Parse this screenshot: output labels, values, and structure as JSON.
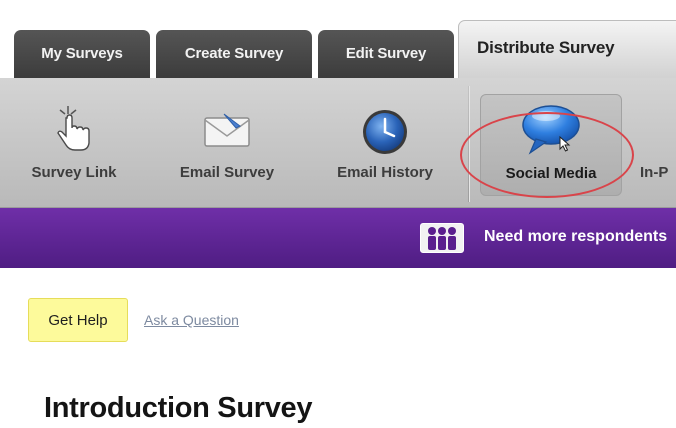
{
  "tabs": [
    {
      "label": "My Surveys"
    },
    {
      "label": "Create Survey"
    },
    {
      "label": "Edit Survey"
    },
    {
      "label": "Distribute Survey",
      "active": true
    }
  ],
  "toolbar": {
    "items": [
      {
        "label": "Survey Link",
        "icon": "hand-pointer-icon"
      },
      {
        "label": "Email Survey",
        "icon": "envelope-icon"
      },
      {
        "label": "Email History",
        "icon": "clock-icon"
      },
      {
        "label": "Social Media",
        "icon": "speech-bubble-icon",
        "selected": true
      },
      {
        "label": "In-P",
        "icon": ""
      }
    ]
  },
  "banner": {
    "text": "Need more respondents",
    "icon": "people-icon"
  },
  "content": {
    "help_button": "Get Help",
    "ask_link": "Ask a Question",
    "page_title": "Introduction Survey"
  },
  "colors": {
    "tab_dark": "#474747",
    "toolbar_bg": "#c6c6c6",
    "banner_purple": "#5e2596",
    "help_yellow": "#fdfa9b",
    "highlight_red": "#d9444a"
  }
}
